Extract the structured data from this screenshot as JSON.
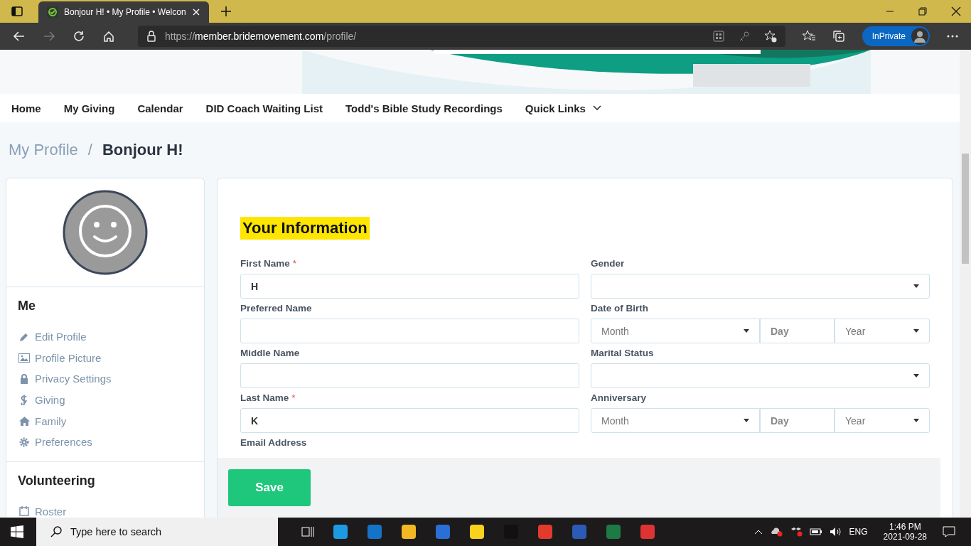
{
  "browser": {
    "tab_title": "Bonjour H! • My Profile • Welcon",
    "url_scheme": "https://",
    "url_host": "member.bridemovement.com",
    "url_path": "/profile/",
    "inprivate": "InPrivate"
  },
  "nav": [
    {
      "label": "Home",
      "kind": "link"
    },
    {
      "label": "My Giving",
      "kind": "link"
    },
    {
      "label": "Calendar",
      "kind": "link"
    },
    {
      "label": "DID Coach Waiting List",
      "kind": "link"
    },
    {
      "label": "Todd's Bible Study Recordings",
      "kind": "link"
    },
    {
      "label": "Quick Links",
      "kind": "dropdown"
    }
  ],
  "breadcrumb": {
    "parent": "My Profile",
    "separator": "/",
    "current": "Bonjour H!"
  },
  "sidebar": [
    {
      "title": "Me",
      "items": [
        "Edit Profile",
        "Profile Picture",
        "Privacy Settings",
        "Giving",
        "Family",
        "Preferences"
      ]
    },
    {
      "title": "Volunteering",
      "items": [
        "Roster"
      ]
    }
  ],
  "form": {
    "heading": "Your Information",
    "rows": [
      {
        "left": {
          "label": "First Name",
          "required": true,
          "value": "H"
        },
        "right": {
          "label": "Gender",
          "kind": "select"
        }
      },
      {
        "left": {
          "label": "Preferred Name",
          "required": false
        },
        "right": {
          "label": "Date of Birth",
          "kind": "date",
          "parts": [
            "Month",
            "Day",
            "Year"
          ]
        }
      },
      {
        "left": {
          "label": "Middle Name",
          "required": false
        },
        "right": {
          "label": "Marital Status",
          "kind": "select"
        }
      },
      {
        "left": {
          "label": "Last Name",
          "required": true,
          "value": "K"
        },
        "right": {
          "label": "Anniversary",
          "kind": "date",
          "parts": [
            "Month",
            "Day",
            "Year"
          ]
        }
      }
    ],
    "next_label": "Email Address",
    "required_mark": "*",
    "save": "Save"
  },
  "taskbar": {
    "search_placeholder": "Type here to search",
    "language": "ENG",
    "time": "1:46 PM",
    "date": "2021-09-28"
  }
}
